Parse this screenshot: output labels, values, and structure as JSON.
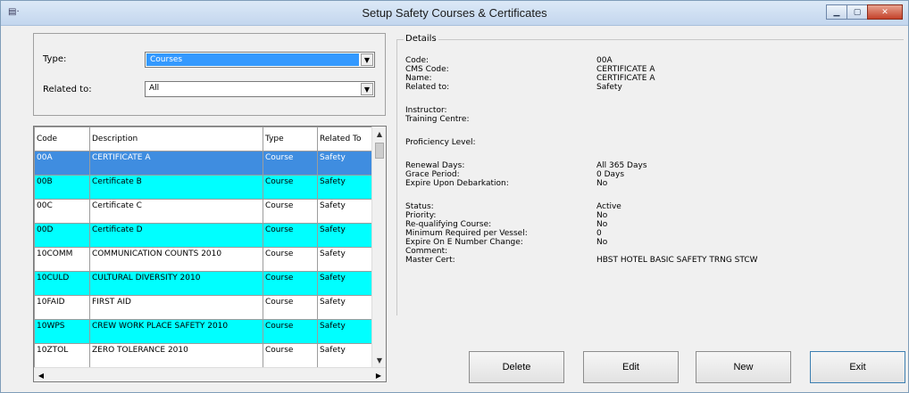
{
  "window": {
    "title": "Setup Safety Courses & Certificates",
    "app_icon_glyph": "▤·",
    "controls": {
      "minimize": "▁",
      "maximize": "▢",
      "close": "✕"
    }
  },
  "filter": {
    "type_label": "Type:",
    "type_value": "Courses",
    "related_label": "Related to:",
    "related_value": "All"
  },
  "grid": {
    "columns": [
      "Code",
      "Description",
      "Type",
      "Related To"
    ],
    "rows": [
      [
        "00A",
        "CERTIFICATE A",
        "Course",
        "Safety"
      ],
      [
        "00B",
        "Certificate B",
        "Course",
        "Safety"
      ],
      [
        "00C",
        "Certificate C",
        "Course",
        "Safety"
      ],
      [
        "00D",
        "Certificate D",
        "Course",
        "Safety"
      ],
      [
        "10COMM",
        "COMMUNICATION COUNTS 2010",
        "Course",
        "Safety"
      ],
      [
        "10CULD",
        "CULTURAL DIVERSITY 2010",
        "Course",
        "Safety"
      ],
      [
        "10FAID",
        "FIRST AID",
        "Course",
        "Safety"
      ],
      [
        "10WPS",
        "CREW WORK PLACE SAFETY 2010",
        "Course",
        "Safety"
      ],
      [
        "10ZTOL",
        "ZERO TOLERANCE 2010",
        "Course",
        "Safety"
      ]
    ]
  },
  "details": {
    "legend": "Details",
    "code_label": "Code:",
    "code": "00A",
    "cms_label": "CMS Code:",
    "cms": "CERTIFICATE A",
    "name_label": "Name:",
    "name": "CERTIFICATE A",
    "related_label": "Related to:",
    "related": "Safety",
    "instructor_label": "Instructor:",
    "centre_label": "Training Centre:",
    "proficiency_label": "Proficiency Level:",
    "renewal_label": "Renewal Days:",
    "renewal": "All 365 Days",
    "grace_label": "Grace Period:",
    "grace": "0 Days",
    "expire_label": "Expire Upon Debarkation:",
    "expire": "No",
    "status_label": "Status:",
    "status": "Active",
    "priority_label": "Priority:",
    "priority": "No",
    "requal_label": "Re-qualifying Course:",
    "requal": "No",
    "minreq_label": "Minimum Required per Vessel:",
    "minreq": "0",
    "expire_e_label": "Expire On E Number Change:",
    "expire_e": "No",
    "comment_label": "Comment:",
    "master_label": "Master Cert:",
    "master": "HBST HOTEL BASIC SAFETY TRNG STCW"
  },
  "buttons": {
    "delete": "Delete",
    "edit": "Edit",
    "new": "New",
    "exit": "Exit"
  }
}
